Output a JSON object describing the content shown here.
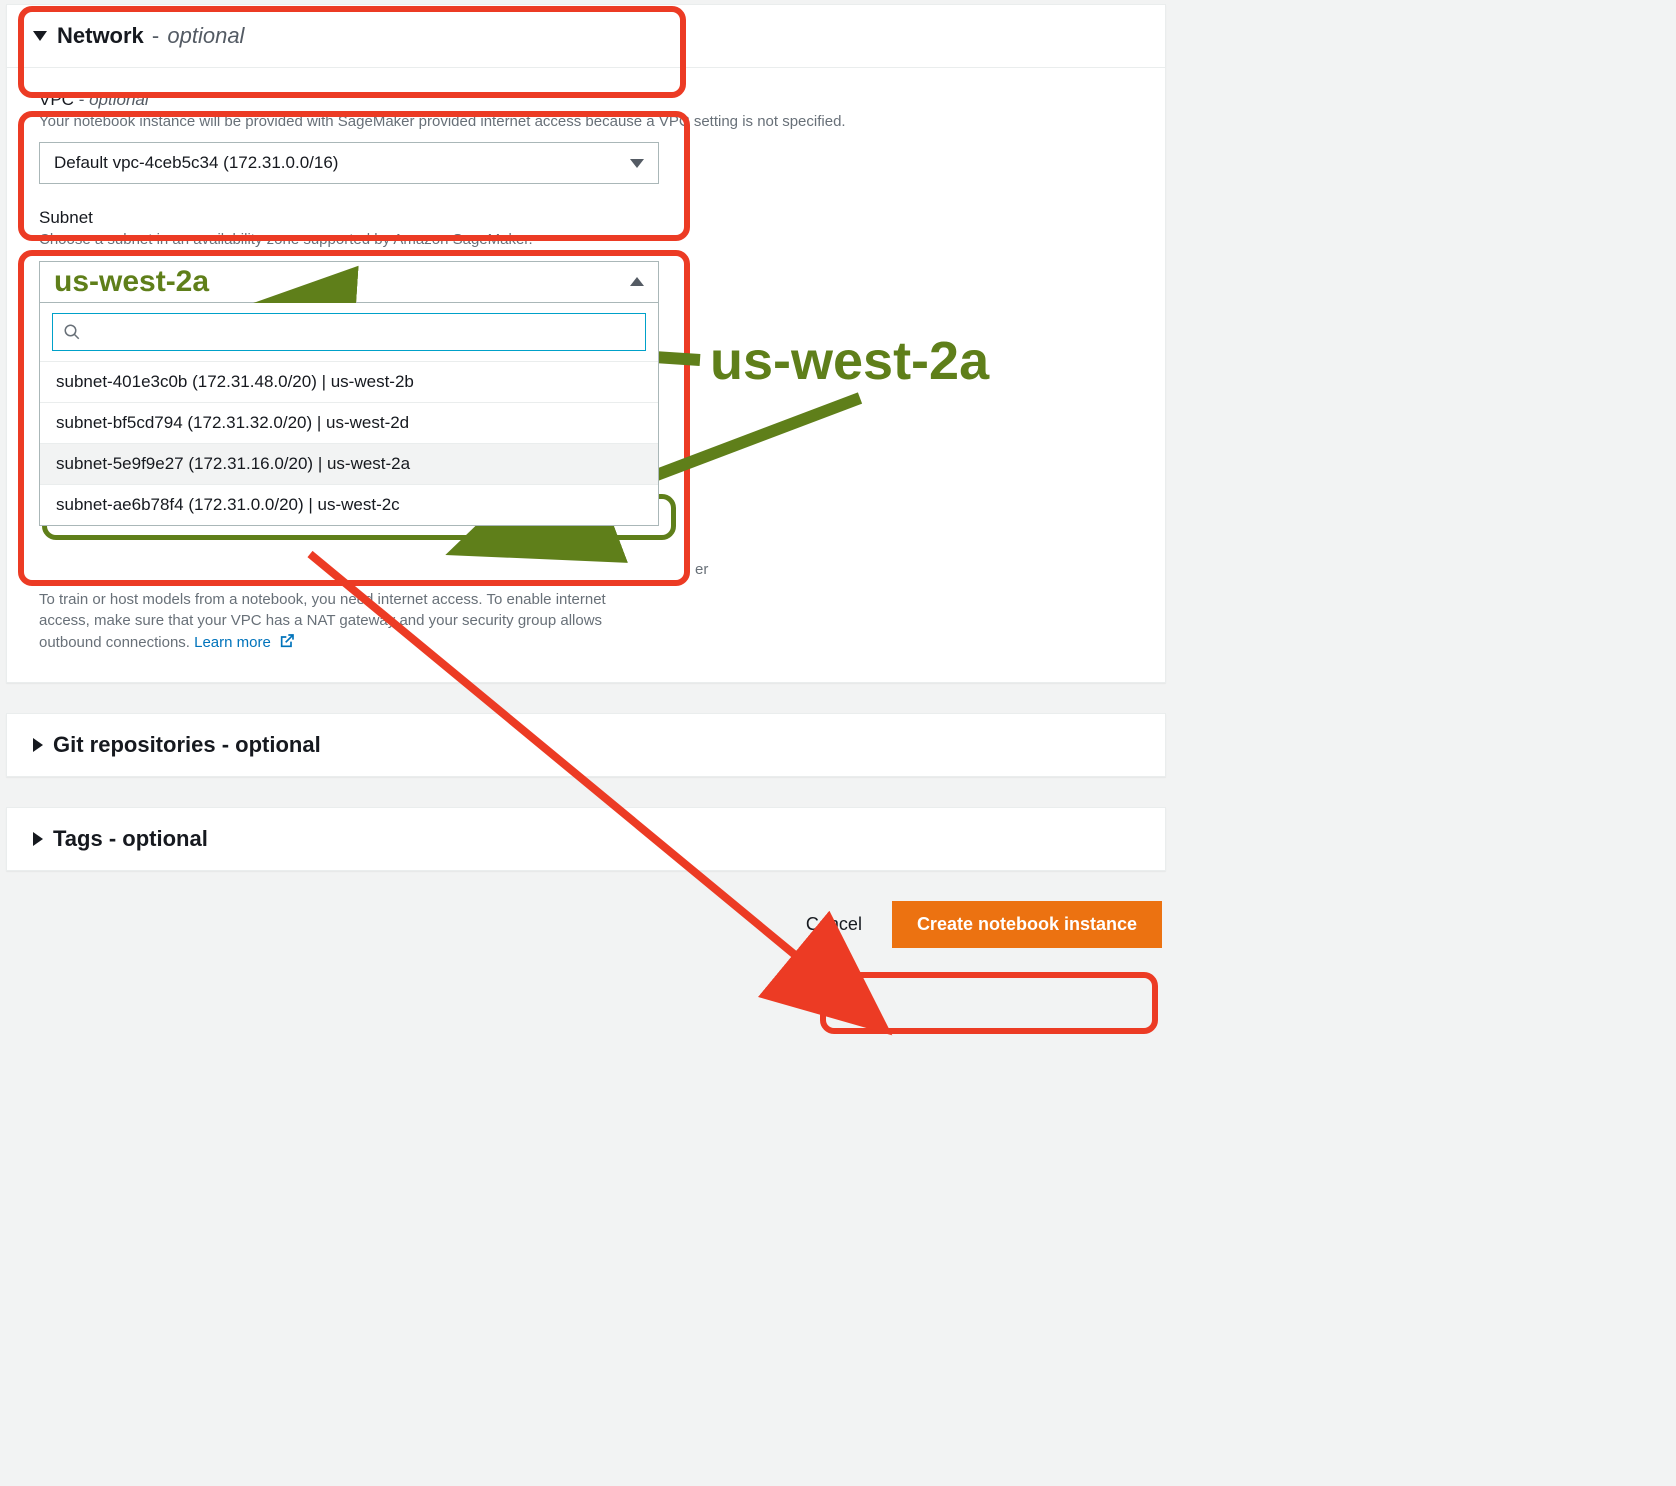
{
  "sections": {
    "network": {
      "title": "Network",
      "optional": "optional"
    },
    "git": {
      "title": "Git repositories",
      "optional": "optional"
    },
    "tags": {
      "title": "Tags",
      "optional": "optional"
    }
  },
  "vpc": {
    "label": "VPC",
    "optional": "optional",
    "description": "Your notebook instance will be provided with SageMaker provided internet access because a VPC setting is not specified.",
    "selected": "Default vpc-4ceb5c34 (172.31.0.0/16)"
  },
  "subnet": {
    "label": "Subnet",
    "description": "Choose a subnet in an availability zone supported by Amazon SageMaker.",
    "selected": "us-west-2a",
    "search_placeholder": "",
    "options": [
      "subnet-401e3c0b (172.31.48.0/20) | us-west-2b",
      "subnet-bf5cd794 (172.31.32.0/20) | us-west-2d",
      "subnet-5e9f9e27 (172.31.16.0/20) | us-west-2a",
      "subnet-ae6b78f4 (172.31.0.0/20) | us-west-2c"
    ],
    "hover_index": 2
  },
  "internet_note": {
    "trailing_word": "er",
    "line1": "To train or host models from a notebook, you need internet access. To enable internet",
    "line2": "access, make sure that your VPC has a NAT gateway and your security group allows",
    "line3_prefix": "outbound connections.  ",
    "learn_more": "Learn more"
  },
  "footer": {
    "cancel": "Cancel",
    "create": "Create notebook instance"
  },
  "annotation": {
    "label": "us-west-2a"
  }
}
